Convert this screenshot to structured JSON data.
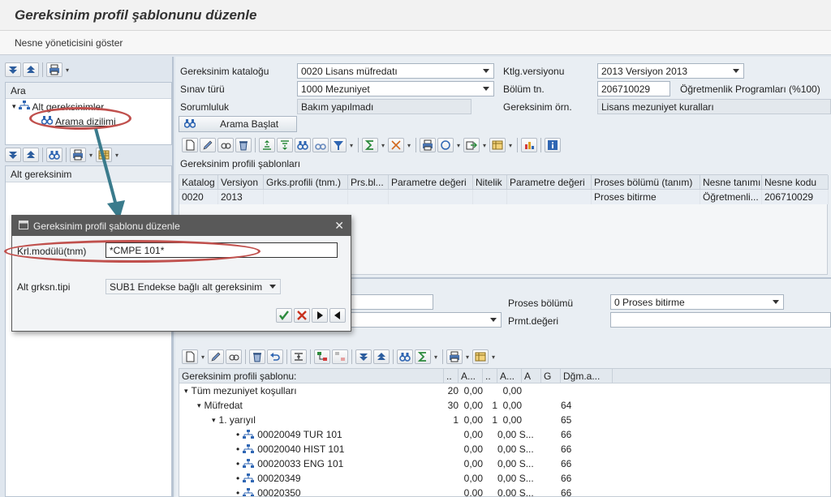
{
  "window": {
    "title": "Gereksinim profil şablonunu düzenle"
  },
  "menu": {
    "show_object_manager": "Nesne yöneticisini göster"
  },
  "left": {
    "search_header": "Ara",
    "tree_root": "Alt gereksinimler",
    "tree_child": "Arama dizilimi",
    "sub_header": "Alt gereksinim"
  },
  "form": {
    "catalog_label": "Gereksinim kataloğu",
    "catalog_value": "0020 Lisans müfredatı",
    "catalog_version_label": "Ktlg.versiyonu",
    "catalog_version_value": "2013 Versiyon 2013",
    "exam_type_label": "Sınav türü",
    "exam_type_value": "1000 Mezuniyet",
    "dept_label": "Bölüm tn.",
    "dept_value": "206710029",
    "dept_text": "Öğretmenlik Programları (%100)",
    "responsibility_label": "Sorumluluk",
    "responsibility_value": "Bakım yapılmadı",
    "req_example_label": "Gereksinim örn.",
    "req_example_value": "Lisans mezuniyet kuralları",
    "search_start": "Arama Başlat"
  },
  "templates_grid": {
    "title": "Gereksinim profili şablonları",
    "columns": [
      "Katalog",
      "Versiyon",
      "Grks.profili (tnm.)",
      "Prs.bl...",
      "Parametre değeri",
      "Nitelik",
      "Parametre değeri",
      "Proses bölümü (tanım)",
      "Nesne tanımı",
      "Nesne kodu"
    ],
    "row": [
      "0020",
      "2013",
      "",
      "",
      "",
      "",
      "",
      "Proses bitirme",
      "Öğretmenli...",
      "206710029"
    ]
  },
  "lower_form": {
    "process_label": "Proses bölümü",
    "process_value": "0 Proses bitirme",
    "param_label": "Prmt.değeri"
  },
  "tree_grid": {
    "columns": [
      "Gereksinim profili şablonu:",
      "..",
      "A...",
      "..",
      "A...",
      "A",
      "G",
      "Dğm.a..."
    ],
    "rows": [
      {
        "label": "Tüm mezuniyet koşulları",
        "c1": "20",
        "c2": "0,00",
        "c3": "",
        "c4": "0,00",
        "c5": "",
        "c6": "",
        "c7": ""
      },
      {
        "label": "Müfredat",
        "c1": "30",
        "c2": "0,00",
        "c3": "1",
        "c4": "0,00",
        "c5": "",
        "c6": "",
        "c7": "64"
      },
      {
        "label": "1. yarıyıl",
        "c1": "1",
        "c2": "0,00",
        "c3": "1",
        "c4": "0,00",
        "c5": "",
        "c6": "",
        "c7": "65"
      },
      {
        "label": "00020049 TUR 101",
        "c1": "",
        "c2": "0,00",
        "c3": "",
        "c4": "0,00 S...",
        "c5": "",
        "c6": "",
        "c7": "66"
      },
      {
        "label": "00020040 HIST 101",
        "c1": "",
        "c2": "0,00",
        "c3": "",
        "c4": "0,00 S...",
        "c5": "",
        "c6": "",
        "c7": "66"
      },
      {
        "label": "00020033 ENG 101",
        "c1": "",
        "c2": "0,00",
        "c3": "",
        "c4": "0,00 S...",
        "c5": "",
        "c6": "",
        "c7": "66"
      },
      {
        "label": "00020349",
        "c1": "",
        "c2": "0,00",
        "c3": "",
        "c4": "0,00 S...",
        "c5": "",
        "c6": "",
        "c7": "66"
      },
      {
        "label": "00020350",
        "c1": "",
        "c2": "0,00",
        "c3": "",
        "c4": "0,00 S...",
        "c5": "",
        "c6": "",
        "c7": "66"
      }
    ]
  },
  "dialog": {
    "title": "Gereksinim profil şablonu düzenle",
    "module_label": "Krl.modülü(tnm)",
    "module_value": "*CMPE 101*",
    "subtype_label": "Alt grksn.tipi",
    "subtype_value": "SUB1 Endekse bağlı alt gereksinim"
  },
  "colors": {
    "annotation": "#c0504d",
    "arrow": "#3a7b8c",
    "dialog_title_bg": "#595959"
  }
}
